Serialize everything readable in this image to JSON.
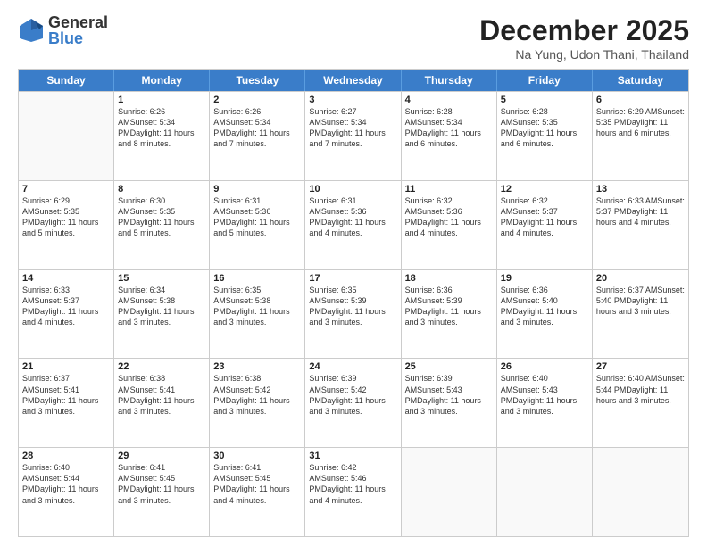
{
  "logo": {
    "general": "General",
    "blue": "Blue"
  },
  "title": "December 2025",
  "location": "Na Yung, Udon Thani, Thailand",
  "weekdays": [
    "Sunday",
    "Monday",
    "Tuesday",
    "Wednesday",
    "Thursday",
    "Friday",
    "Saturday"
  ],
  "weeks": [
    [
      {
        "day": "",
        "sunrise": "",
        "sunset": "",
        "daylight": ""
      },
      {
        "day": "1",
        "sunrise": "Sunrise: 6:26 AM",
        "sunset": "Sunset: 5:34 PM",
        "daylight": "Daylight: 11 hours and 8 minutes."
      },
      {
        "day": "2",
        "sunrise": "Sunrise: 6:26 AM",
        "sunset": "Sunset: 5:34 PM",
        "daylight": "Daylight: 11 hours and 7 minutes."
      },
      {
        "day": "3",
        "sunrise": "Sunrise: 6:27 AM",
        "sunset": "Sunset: 5:34 PM",
        "daylight": "Daylight: 11 hours and 7 minutes."
      },
      {
        "day": "4",
        "sunrise": "Sunrise: 6:28 AM",
        "sunset": "Sunset: 5:34 PM",
        "daylight": "Daylight: 11 hours and 6 minutes."
      },
      {
        "day": "5",
        "sunrise": "Sunrise: 6:28 AM",
        "sunset": "Sunset: 5:35 PM",
        "daylight": "Daylight: 11 hours and 6 minutes."
      },
      {
        "day": "6",
        "sunrise": "Sunrise: 6:29 AM",
        "sunset": "Sunset: 5:35 PM",
        "daylight": "Daylight: 11 hours and 6 minutes."
      }
    ],
    [
      {
        "day": "7",
        "sunrise": "Sunrise: 6:29 AM",
        "sunset": "Sunset: 5:35 PM",
        "daylight": "Daylight: 11 hours and 5 minutes."
      },
      {
        "day": "8",
        "sunrise": "Sunrise: 6:30 AM",
        "sunset": "Sunset: 5:35 PM",
        "daylight": "Daylight: 11 hours and 5 minutes."
      },
      {
        "day": "9",
        "sunrise": "Sunrise: 6:31 AM",
        "sunset": "Sunset: 5:36 PM",
        "daylight": "Daylight: 11 hours and 5 minutes."
      },
      {
        "day": "10",
        "sunrise": "Sunrise: 6:31 AM",
        "sunset": "Sunset: 5:36 PM",
        "daylight": "Daylight: 11 hours and 4 minutes."
      },
      {
        "day": "11",
        "sunrise": "Sunrise: 6:32 AM",
        "sunset": "Sunset: 5:36 PM",
        "daylight": "Daylight: 11 hours and 4 minutes."
      },
      {
        "day": "12",
        "sunrise": "Sunrise: 6:32 AM",
        "sunset": "Sunset: 5:37 PM",
        "daylight": "Daylight: 11 hours and 4 minutes."
      },
      {
        "day": "13",
        "sunrise": "Sunrise: 6:33 AM",
        "sunset": "Sunset: 5:37 PM",
        "daylight": "Daylight: 11 hours and 4 minutes."
      }
    ],
    [
      {
        "day": "14",
        "sunrise": "Sunrise: 6:33 AM",
        "sunset": "Sunset: 5:37 PM",
        "daylight": "Daylight: 11 hours and 4 minutes."
      },
      {
        "day": "15",
        "sunrise": "Sunrise: 6:34 AM",
        "sunset": "Sunset: 5:38 PM",
        "daylight": "Daylight: 11 hours and 3 minutes."
      },
      {
        "day": "16",
        "sunrise": "Sunrise: 6:35 AM",
        "sunset": "Sunset: 5:38 PM",
        "daylight": "Daylight: 11 hours and 3 minutes."
      },
      {
        "day": "17",
        "sunrise": "Sunrise: 6:35 AM",
        "sunset": "Sunset: 5:39 PM",
        "daylight": "Daylight: 11 hours and 3 minutes."
      },
      {
        "day": "18",
        "sunrise": "Sunrise: 6:36 AM",
        "sunset": "Sunset: 5:39 PM",
        "daylight": "Daylight: 11 hours and 3 minutes."
      },
      {
        "day": "19",
        "sunrise": "Sunrise: 6:36 AM",
        "sunset": "Sunset: 5:40 PM",
        "daylight": "Daylight: 11 hours and 3 minutes."
      },
      {
        "day": "20",
        "sunrise": "Sunrise: 6:37 AM",
        "sunset": "Sunset: 5:40 PM",
        "daylight": "Daylight: 11 hours and 3 minutes."
      }
    ],
    [
      {
        "day": "21",
        "sunrise": "Sunrise: 6:37 AM",
        "sunset": "Sunset: 5:41 PM",
        "daylight": "Daylight: 11 hours and 3 minutes."
      },
      {
        "day": "22",
        "sunrise": "Sunrise: 6:38 AM",
        "sunset": "Sunset: 5:41 PM",
        "daylight": "Daylight: 11 hours and 3 minutes."
      },
      {
        "day": "23",
        "sunrise": "Sunrise: 6:38 AM",
        "sunset": "Sunset: 5:42 PM",
        "daylight": "Daylight: 11 hours and 3 minutes."
      },
      {
        "day": "24",
        "sunrise": "Sunrise: 6:39 AM",
        "sunset": "Sunset: 5:42 PM",
        "daylight": "Daylight: 11 hours and 3 minutes."
      },
      {
        "day": "25",
        "sunrise": "Sunrise: 6:39 AM",
        "sunset": "Sunset: 5:43 PM",
        "daylight": "Daylight: 11 hours and 3 minutes."
      },
      {
        "day": "26",
        "sunrise": "Sunrise: 6:40 AM",
        "sunset": "Sunset: 5:43 PM",
        "daylight": "Daylight: 11 hours and 3 minutes."
      },
      {
        "day": "27",
        "sunrise": "Sunrise: 6:40 AM",
        "sunset": "Sunset: 5:44 PM",
        "daylight": "Daylight: 11 hours and 3 minutes."
      }
    ],
    [
      {
        "day": "28",
        "sunrise": "Sunrise: 6:40 AM",
        "sunset": "Sunset: 5:44 PM",
        "daylight": "Daylight: 11 hours and 3 minutes."
      },
      {
        "day": "29",
        "sunrise": "Sunrise: 6:41 AM",
        "sunset": "Sunset: 5:45 PM",
        "daylight": "Daylight: 11 hours and 3 minutes."
      },
      {
        "day": "30",
        "sunrise": "Sunrise: 6:41 AM",
        "sunset": "Sunset: 5:45 PM",
        "daylight": "Daylight: 11 hours and 4 minutes."
      },
      {
        "day": "31",
        "sunrise": "Sunrise: 6:42 AM",
        "sunset": "Sunset: 5:46 PM",
        "daylight": "Daylight: 11 hours and 4 minutes."
      },
      {
        "day": "",
        "sunrise": "",
        "sunset": "",
        "daylight": ""
      },
      {
        "day": "",
        "sunrise": "",
        "sunset": "",
        "daylight": ""
      },
      {
        "day": "",
        "sunrise": "",
        "sunset": "",
        "daylight": ""
      }
    ]
  ]
}
